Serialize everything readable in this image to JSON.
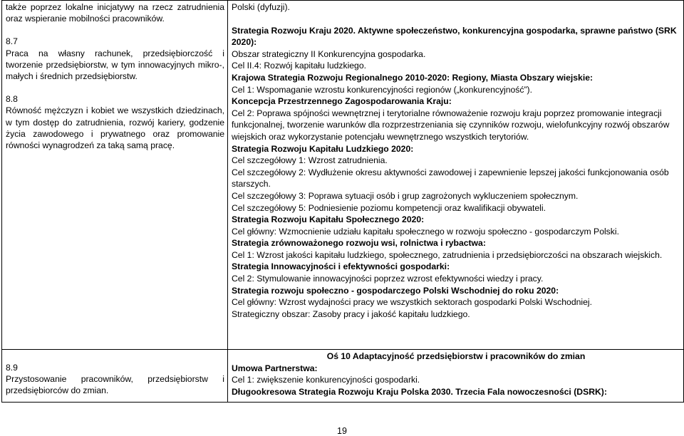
{
  "row1": {
    "left": {
      "intro": "także poprzez lokalne inicjatywy na rzecz zatrudnienia oraz wspieranie mobilności pracowników.",
      "item_7_number": "8.7",
      "item_7_text": "Praca na własny rachunek, przedsiębiorczość i tworzenie przedsiębiorstw, w tym innowacyjnych mikro-, małych i średnich przedsiębiorstw.",
      "item_8_number": "8.8",
      "item_8_text": "Równość mężczyzn i kobiet we wszystkich dziedzinach, w tym dostęp do zatrudnienia, rozwój kariery, godzenie życia zawodowego i prywatnego oraz promowanie równości wynagrodzeń za taką samą pracę."
    },
    "right": {
      "lines": [
        {
          "text": "Polski (dyfuzji).",
          "bold": false,
          "gap_after": true
        },
        {
          "text": "Strategia Rozwoju Kraju 2020. Aktywne społeczeństwo, konkurencyjna gospodarka, sprawne państwo (SRK 2020):",
          "bold": true
        },
        {
          "text": "Obszar strategiczny II Konkurencyjna gospodarka.",
          "bold": false
        },
        {
          "text": "Cel II.4: Rozwój kapitału ludzkiego.",
          "bold": false
        },
        {
          "text": "Krajowa Strategia Rozwoju Regionalnego 2010-2020: Regiony, Miasta Obszary wiejskie:",
          "bold": true
        },
        {
          "text": "Cel 1: Wspomaganie wzrostu konkurencyjności regionów („konkurencyjność”).",
          "bold": false
        },
        {
          "text": "Koncepcja Przestrzennego Zagospodarowania Kraju:",
          "bold": true
        },
        {
          "text": "Cel 2: Poprawa spójności wewnętrznej i terytorialne równoważenie rozwoju kraju poprzez promowanie integracji funkcjonalnej, tworzenie warunków dla rozprzestrzeniania się czynników rozwoju, wielofunkcyjny rozwój obszarów wiejskich oraz wykorzystanie potencjału wewnętrznego wszystkich terytoriów.",
          "bold": false
        },
        {
          "text": "Strategia Rozwoju Kapitału Ludzkiego 2020:",
          "bold": true
        },
        {
          "text": "Cel szczegółowy 1: Wzrost zatrudnienia.",
          "bold": false
        },
        {
          "text": "Cel szczegółowy 2: Wydłużenie okresu aktywności zawodowej i zapewnienie lepszej jakości funkcjonowania osób starszych.",
          "bold": false
        },
        {
          "text": "Cel szczegółowy 3: Poprawa sytuacji osób i grup zagrożonych wykluczeniem społecznym.",
          "bold": false
        },
        {
          "text": "Cel szczegółowy 5: Podniesienie poziomu kompetencji oraz kwalifikacji obywateli.",
          "bold": false
        },
        {
          "text": "Strategia Rozwoju Kapitału Społecznego 2020:",
          "bold": true
        },
        {
          "text": "Cel główny: Wzmocnienie udziału kapitału społecznego w rozwoju społeczno - gospodarczym Polski.",
          "bold": false
        },
        {
          "text": "Strategia zrównoważonego rozwoju wsi, rolnictwa i rybactwa:",
          "bold": true
        },
        {
          "text": "Cel 1: Wzrost jakości kapitału ludzkiego, społecznego, zatrudnienia i przedsiębiorczości na obszarach wiejskich.",
          "bold": false
        },
        {
          "text": "Strategia Innowacyjności i efektywności gospodarki:",
          "bold": true
        },
        {
          "text": "Cel 2: Stymulowanie innowacyjności poprzez wzrost efektywności wiedzy i pracy.",
          "bold": false
        },
        {
          "text": "Strategia rozwoju społeczno - gospodarczego Polski Wschodniej do roku 2020:",
          "bold": true
        },
        {
          "text": "Cel główny: Wzrost wydajności pracy we wszystkich sektorach gospodarki Polski Wschodniej.",
          "bold": false
        },
        {
          "text": "Strategiczny obszar: Zasoby pracy i jakość kapitału ludzkiego.",
          "bold": false
        }
      ]
    }
  },
  "row2": {
    "left": {
      "item_9_number": "8.9",
      "item_9_text": "Przystosowanie pracowników, przedsiębiorstw i przedsiębiorców do zmian."
    },
    "right": {
      "heading": "Oś 10 Adaptacyjność przedsiębiorstw i pracowników do zmian",
      "lines": [
        {
          "text": "Umowa Partnerstwa:",
          "bold": true
        },
        {
          "text": "Cel 1: zwiększenie konkurencyjności gospodarki.",
          "bold": false
        },
        {
          "text": "Długookresowa Strategia Rozwoju Kraju Polska 2030. Trzecia Fala nowoczesności (DSRK):",
          "bold": true
        }
      ]
    }
  },
  "footer": {
    "page_number": "19"
  }
}
